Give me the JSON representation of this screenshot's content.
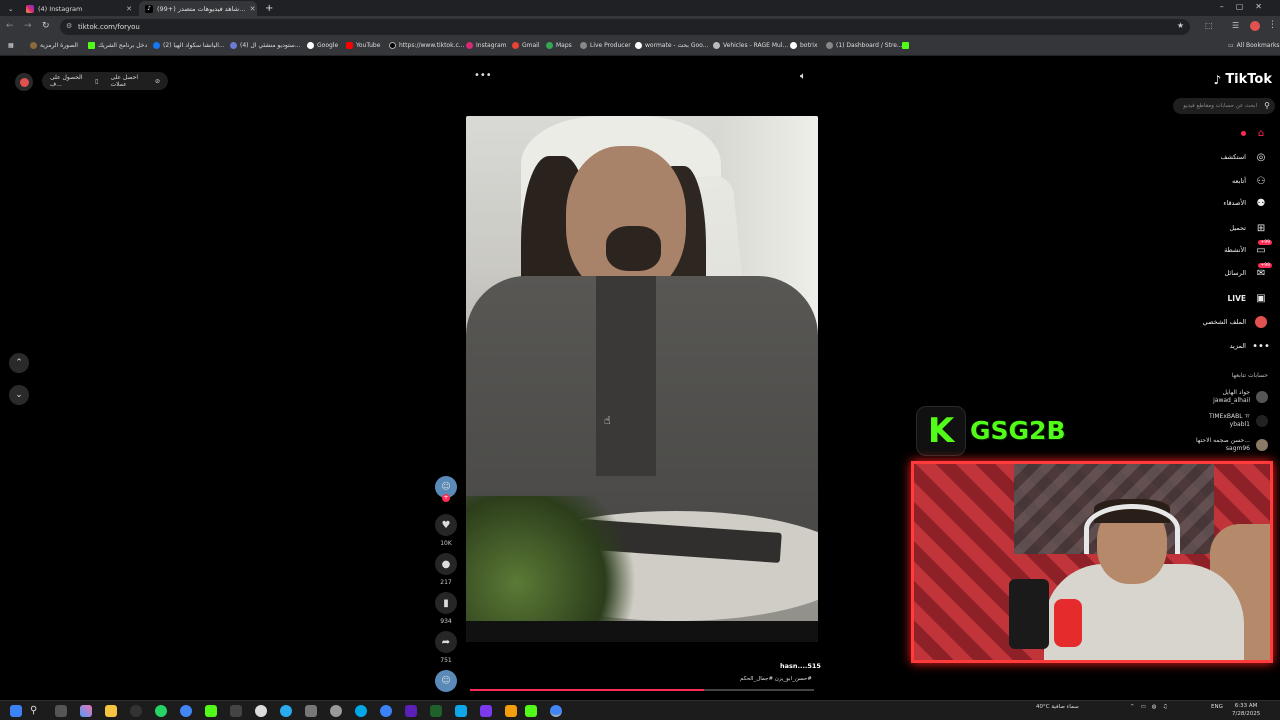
{
  "browser": {
    "tabs": [
      {
        "title": "(4) Instagram",
        "active": false
      },
      {
        "title": "(99+) شاهد فيديوهات متصدر…",
        "active": true
      }
    ],
    "url": "tiktok.com/foryou",
    "bookmarks": [
      "الصورة الرمزية",
      "دخل برنامج الشريك",
      "(2) اليانشا سكواد الهيا...",
      "(4) ستوديو منشئي ال...",
      "Google",
      "YouTube",
      "https://www.tiktok.c...",
      "Instagram",
      "Gmail",
      "Maps",
      "Live Producer",
      "wormate - بحث Goo...",
      "Vehicles - RAGE Mul...",
      "botrix",
      "(1) Dashboard / Stre..."
    ],
    "all_bookmarks": "All Bookmarks"
  },
  "tiktok": {
    "logo": "TikTok",
    "search_placeholder": "ابحث عن حسابات ومقاطع فيديو",
    "top_pills": {
      "effects": "احصل على عملات",
      "get_app": "الحصول على ف..."
    },
    "nav": [
      {
        "label": "",
        "icon": "home-icon"
      },
      {
        "label": "استكشف",
        "icon": "compass-icon"
      },
      {
        "label": "أتابعه",
        "icon": "user-plus-icon"
      },
      {
        "label": "الأصدقاء",
        "icon": "friends-icon"
      },
      {
        "label": "تحميل",
        "icon": "upload-icon"
      },
      {
        "label": "الأنشطة",
        "icon": "activity-icon",
        "badge": "99+"
      },
      {
        "label": "الرسائل",
        "icon": "messages-icon",
        "badge": "99+"
      },
      {
        "label": "LIVE",
        "icon": "live-icon"
      },
      {
        "label": "الملف الشخصي",
        "icon": "profile-icon"
      },
      {
        "label": "المزيد",
        "icon": "more-icon"
      }
    ],
    "following_title": "حسابات تتابعها",
    "following": [
      {
        "name": "جواد الهايل",
        "handle": "jawad_alhail"
      },
      {
        "name": "TIMExBABL ㅠ",
        "handle": "ybabl1"
      },
      {
        "name": "حسن صجمه الاحتها...",
        "handle": "sagm96"
      }
    ],
    "actions": {
      "likes": "10K",
      "comments": "217",
      "saves": "934",
      "shares": "751"
    },
    "video": {
      "author": "hasn....515",
      "tags": "#حسن_ابو_يزن  #جمال_الحكم",
      "progress": 0.68
    }
  },
  "overlay": {
    "brand_letter": "K",
    "channel": "GSG2B"
  },
  "taskbar": {
    "weather": "40°C",
    "weather_text": "سماء صافية",
    "lang": "ENG",
    "time": "6:33 AM",
    "date": "7/28/2025"
  }
}
